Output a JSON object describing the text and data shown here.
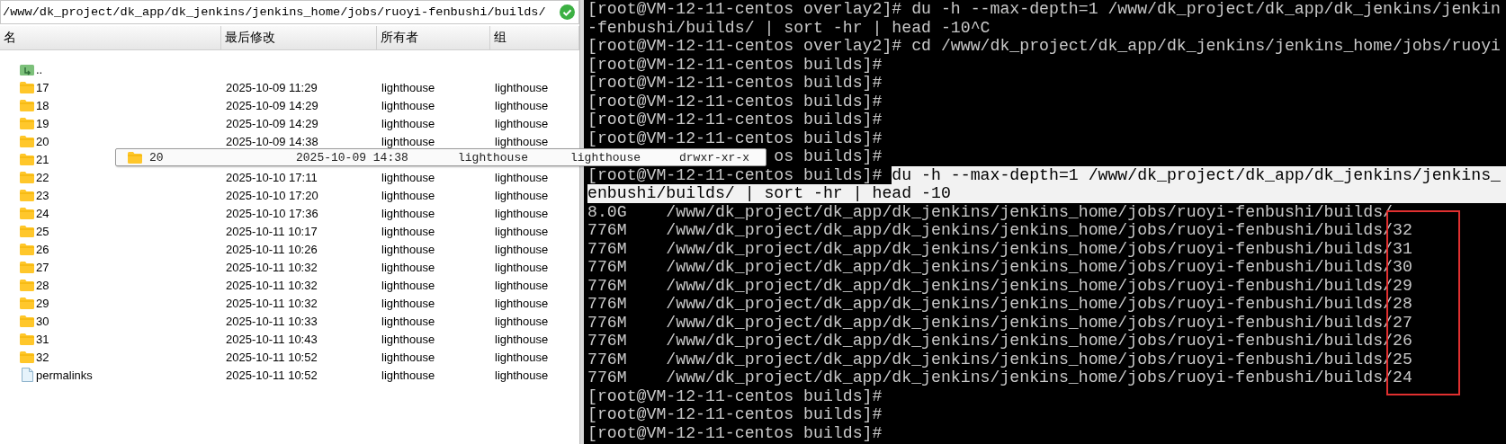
{
  "path_bar": {
    "path": "/www/dk_project/dk_app/dk_jenkins/jenkins_home/jobs/ruoyi-fenbushi/builds/"
  },
  "columns": [
    "名",
    "最后修改",
    "所有者",
    "组"
  ],
  "files": [
    {
      "kind": "parent",
      "name": ".."
    },
    {
      "kind": "folder",
      "name": "17",
      "modified": "2025-10-09 11:29",
      "owner": "lighthouse",
      "group": "lighthouse"
    },
    {
      "kind": "folder",
      "name": "18",
      "modified": "2025-10-09 14:29",
      "owner": "lighthouse",
      "group": "lighthouse"
    },
    {
      "kind": "folder",
      "name": "19",
      "modified": "2025-10-09 14:29",
      "owner": "lighthouse",
      "group": "lighthouse"
    },
    {
      "kind": "folder",
      "name": "20",
      "modified": "2025-10-09 14:38",
      "owner": "lighthouse",
      "group": "lighthouse"
    },
    {
      "kind": "folder",
      "name": "21"
    },
    {
      "kind": "folder",
      "name": "22",
      "modified": "2025-10-10 17:11",
      "owner": "lighthouse",
      "group": "lighthouse"
    },
    {
      "kind": "folder",
      "name": "23",
      "modified": "2025-10-10 17:20",
      "owner": "lighthouse",
      "group": "lighthouse"
    },
    {
      "kind": "folder",
      "name": "24",
      "modified": "2025-10-10 17:36",
      "owner": "lighthouse",
      "group": "lighthouse"
    },
    {
      "kind": "folder",
      "name": "25",
      "modified": "2025-10-11 10:17",
      "owner": "lighthouse",
      "group": "lighthouse"
    },
    {
      "kind": "folder",
      "name": "26",
      "modified": "2025-10-11 10:26",
      "owner": "lighthouse",
      "group": "lighthouse"
    },
    {
      "kind": "folder",
      "name": "27",
      "modified": "2025-10-11 10:32",
      "owner": "lighthouse",
      "group": "lighthouse"
    },
    {
      "kind": "folder",
      "name": "28",
      "modified": "2025-10-11 10:32",
      "owner": "lighthouse",
      "group": "lighthouse"
    },
    {
      "kind": "folder",
      "name": "29",
      "modified": "2025-10-11 10:32",
      "owner": "lighthouse",
      "group": "lighthouse"
    },
    {
      "kind": "folder",
      "name": "30",
      "modified": "2025-10-11 10:33",
      "owner": "lighthouse",
      "group": "lighthouse"
    },
    {
      "kind": "folder",
      "name": "31",
      "modified": "2025-10-11 10:43",
      "owner": "lighthouse",
      "group": "lighthouse"
    },
    {
      "kind": "folder",
      "name": "32",
      "modified": "2025-10-11 10:52",
      "owner": "lighthouse",
      "group": "lighthouse"
    },
    {
      "kind": "file",
      "name": "permalinks",
      "modified": "2025-10-11 10:52",
      "owner": "lighthouse",
      "group": "lighthouse"
    }
  ],
  "tooltip": {
    "name": "20",
    "modified": "2025-10-09 14:38",
    "owner": "lighthouse",
    "group": "lighthouse",
    "permissions": "drwxr-xr-x"
  },
  "terminal": {
    "lines": [
      {
        "segments": [
          {
            "text": "[root@VM-12-11-centos overlay2]# du -h --max-depth=1 /www/dk_project/dk_app/dk_jenkins/jenkin",
            "selected": false
          }
        ]
      },
      {
        "segments": [
          {
            "text": "-fenbushi/builds/ | sort -hr | head -10^C",
            "selected": false
          }
        ]
      },
      {
        "segments": [
          {
            "text": "[root@VM-12-11-centos overlay2]# cd /www/dk_project/dk_app/dk_jenkins/jenkins_home/jobs/ruoyi",
            "selected": false
          }
        ]
      },
      {
        "segments": [
          {
            "text": "[root@VM-12-11-centos builds]#",
            "selected": false
          }
        ]
      },
      {
        "segments": [
          {
            "text": "[root@VM-12-11-centos builds]#",
            "selected": false
          }
        ]
      },
      {
        "segments": [
          {
            "text": "[root@VM-12-11-centos builds]#",
            "selected": false
          }
        ]
      },
      {
        "segments": [
          {
            "text": "[root@VM-12-11-centos builds]#",
            "selected": false
          }
        ]
      },
      {
        "segments": [
          {
            "text": "[root@VM-12-11-centos builds]#",
            "selected": false
          }
        ]
      },
      {
        "kind": "covered",
        "segments": [
          {
            "text": "os builds]#",
            "selected": false
          }
        ]
      },
      {
        "segments": [
          {
            "text": "[root@VM-12-11-centos builds]# ",
            "selected": false
          },
          {
            "text": "du -h --max-depth=1 /www/dk_project/dk_app/dk_jenkins/jenkins_",
            "selected": true
          }
        ]
      },
      {
        "segments": [
          {
            "text": "enbushi/builds/ | sort -hr | head -10",
            "selected": true
          }
        ]
      },
      {
        "segments": [
          {
            "text": "8.0G    /www/dk_project/dk_app/dk_jenkins/jenkins_home/jobs/ruoyi-fenbushi/builds/",
            "selected": false
          }
        ]
      },
      {
        "segments": [
          {
            "text": "776M    /www/dk_project/dk_app/dk_jenkins/jenkins_home/jobs/ruoyi-fenbushi/builds/32",
            "selected": false
          }
        ]
      },
      {
        "segments": [
          {
            "text": "776M    /www/dk_project/dk_app/dk_jenkins/jenkins_home/jobs/ruoyi-fenbushi/builds/31",
            "selected": false
          }
        ]
      },
      {
        "segments": [
          {
            "text": "776M    /www/dk_project/dk_app/dk_jenkins/jenkins_home/jobs/ruoyi-fenbushi/builds/30",
            "selected": false
          }
        ]
      },
      {
        "segments": [
          {
            "text": "776M    /www/dk_project/dk_app/dk_jenkins/jenkins_home/jobs/ruoyi-fenbushi/builds/29",
            "selected": false
          }
        ]
      },
      {
        "segments": [
          {
            "text": "776M    /www/dk_project/dk_app/dk_jenkins/jenkins_home/jobs/ruoyi-fenbushi/builds/28",
            "selected": false
          }
        ]
      },
      {
        "segments": [
          {
            "text": "776M    /www/dk_project/dk_app/dk_jenkins/jenkins_home/jobs/ruoyi-fenbushi/builds/27",
            "selected": false
          }
        ]
      },
      {
        "segments": [
          {
            "text": "776M    /www/dk_project/dk_app/dk_jenkins/jenkins_home/jobs/ruoyi-fenbushi/builds/26",
            "selected": false
          }
        ]
      },
      {
        "segments": [
          {
            "text": "776M    /www/dk_project/dk_app/dk_jenkins/jenkins_home/jobs/ruoyi-fenbushi/builds/25",
            "selected": false
          }
        ]
      },
      {
        "segments": [
          {
            "text": "776M    /www/dk_project/dk_app/dk_jenkins/jenkins_home/jobs/ruoyi-fenbushi/builds/24",
            "selected": false
          }
        ]
      },
      {
        "segments": [
          {
            "text": "[root@VM-12-11-centos builds]#",
            "selected": false
          }
        ]
      },
      {
        "segments": [
          {
            "text": "[root@VM-12-11-centos builds]#",
            "selected": false
          }
        ]
      },
      {
        "segments": [
          {
            "text": "[root@VM-12-11-centos builds]#",
            "selected": false
          }
        ]
      }
    ]
  }
}
